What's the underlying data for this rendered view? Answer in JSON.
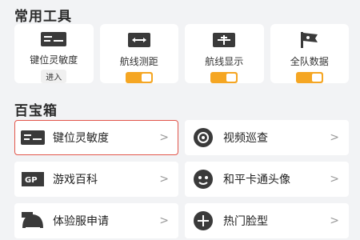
{
  "sections": {
    "tools_title": "常用工具",
    "box_title": "百宝箱"
  },
  "tools": [
    {
      "label": "键位灵敏度",
      "chip": "进入",
      "icon": "keyboard-sliders-icon"
    },
    {
      "label": "航线测距",
      "icon": "distance-arrow-icon",
      "toggle": "on"
    },
    {
      "label": "航线显示",
      "icon": "airplane-icon",
      "toggle": "on"
    },
    {
      "label": "全队数据",
      "icon": "team-flag-icon",
      "toggle": "on"
    }
  ],
  "box_items": [
    {
      "label": "键位灵敏度",
      "icon": "keyboard-sliders-icon"
    },
    {
      "label": "视频巡查",
      "icon": "video-target-icon"
    },
    {
      "label": "游戏百科",
      "icon": "gp-icon"
    },
    {
      "label": "和平卡通头像",
      "icon": "cartoon-face-icon"
    },
    {
      "label": "体验服申请",
      "icon": "beta-helmet-icon"
    },
    {
      "label": "热门脸型",
      "icon": "face-shape-icon"
    }
  ],
  "colors": {
    "accent": "#f5a623",
    "highlight": "#e2554a"
  }
}
